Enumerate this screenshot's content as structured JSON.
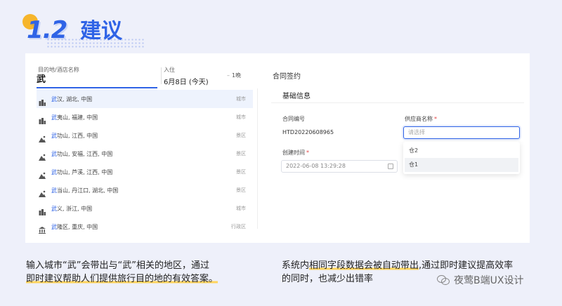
{
  "heading": {
    "number": "1.2",
    "title": "建议"
  },
  "search": {
    "destination_label": "目的地/酒店名称",
    "query": "武",
    "checkin_label": "入住",
    "checkin_value": "6月8日 (今天)",
    "nights": "1晚",
    "results": [
      {
        "highlight": "武",
        "rest": "汉, 湖北, 中国",
        "type": "城市",
        "icon": "city-icon"
      },
      {
        "highlight": "武",
        "rest": "夷山, 福建, 中国",
        "type": "城市",
        "icon": "city-icon"
      },
      {
        "highlight": "武",
        "rest": "功山, 江西, 中国",
        "type": "景区",
        "icon": "mountain-icon"
      },
      {
        "highlight": "武",
        "rest": "功山, 安福, 江西, 中国",
        "type": "景区",
        "icon": "mountain-icon"
      },
      {
        "highlight": "武",
        "rest": "功山, 芦溪, 江西, 中国",
        "type": "景区",
        "icon": "mountain-icon"
      },
      {
        "highlight": "武",
        "rest": "当山, 丹江口, 湖北, 中国",
        "type": "景区",
        "icon": "mountain-icon"
      },
      {
        "highlight": "武",
        "rest": "义, 浙江, 中国",
        "type": "城市",
        "icon": "city-icon"
      },
      {
        "highlight": "武",
        "rest": "隆区, 重庆, 中国",
        "type": "行政区",
        "icon": "district-icon"
      }
    ]
  },
  "form": {
    "title": "合同签约",
    "section": "基础信息",
    "contract_no_label": "合同编号",
    "contract_no_value": "HTD20220608965",
    "created_label": "创建时间",
    "required_mark": "*",
    "created_value": "2022-06-08 13:29:28",
    "supplier_label": "供应商名称",
    "supplier_placeholder": "请选择",
    "options": [
      "仓2",
      "仓1"
    ]
  },
  "captions": {
    "left_line1": "输入城市“武”会带出与“武”相关的地区，通过",
    "left_line2": "即时建议帮助人们提供旅行目的地的有效答案。",
    "right_line1_plain": "系统内",
    "right_line1_hl": "相同字段数据会被自动带出",
    "right_line1_rest": ",通过即时建议提高效率",
    "right_line2": "的同时，也减少出错率"
  },
  "watermark": "夜莺B端UX设计",
  "colors": {
    "accent": "#2f63e6",
    "highlight": "#ffd45c",
    "required": "#e54545"
  }
}
